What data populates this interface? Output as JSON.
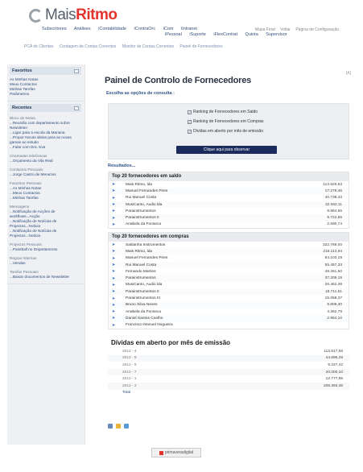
{
  "brand": {
    "part1": "Mais",
    "part2": "Ritmo",
    "accent": "#e2342c"
  },
  "nav_primary": [
    "Subscritores",
    "Análises",
    "iContabilidade",
    "iContraOrc",
    "iCom",
    "iIntranet",
    "iPessoal",
    "iSuporte",
    "iFlexContrat",
    "Quinta",
    "Supervisor"
  ],
  "nav_top_right": [
    "Mapa Final",
    "Voltar",
    "Página de Configuração"
  ],
  "nav_secondary": [
    "PCA de Clientes",
    "Contagem de Contas Correntes",
    "Monitor de Contas Correntes",
    "Painel de Fornecedores"
  ],
  "zoom_label": "[A]",
  "sidebar": {
    "favorites": {
      "title": "Favoritos",
      "items": [
        "As Minhas Notas",
        "Meus Contactos",
        "Minhas Tarefas",
        "Parâmetros"
      ]
    },
    "recent": {
      "title": "Recentes",
      "groups": [
        {
          "label": "Bloco de Notas",
          "items": [
            "...Reunião com departamento sobre Newsletter",
            "...Ligar para a escola da Mariana",
            "...Propor Novas ideias para as novas gamas ao estudo",
            "...Falar com Dra. Eva"
          ]
        },
        {
          "label": "Chamadas telefónicas",
          "items": [
            "...Orçamento da Vila Real"
          ]
        },
        {
          "label": "Contactos Pessoais",
          "items": [
            "...Jorge Castro de Menezes"
          ]
        },
        {
          "label": "Favoritos Pessoais",
          "items": [
            "...As Minhas Notas",
            "...Meus Contactos",
            "...Minhas Tarefas"
          ]
        },
        {
          "label": "Mensagens",
          "items": [
            "...Notificação de Acções de workflows...Acção",
            "...Notificação de Notícias de Projectos...Notícia",
            "...Notificação de Notícias de Projectos...Notícia"
          ]
        },
        {
          "label": "Projectos Pessoais",
          "items": [
            "...Paintball no Departamento"
          ]
        },
        {
          "label": "Regras Internas",
          "items": [
            "...Vendas"
          ]
        },
        {
          "label": "Tarefas Pessoais",
          "items": [
            "...Baixar documentos de Newsletter"
          ]
        }
      ]
    }
  },
  "main": {
    "title": "Painel de Controlo de Fornecedores",
    "options_title": "Escolha as opções de consulta :",
    "options": [
      "Ranking de Fornecedores em Saldo",
      "Ranking de Fornecedores em Compras",
      "Dívidas em aberto por mês de emissão"
    ],
    "button": "Clique aqui para observar",
    "results_label": "Resultados...",
    "section1": {
      "title": "Top 20 fornecedores em saldo",
      "rows": [
        {
          "name": "Mais Ritmo, lda",
          "value": "113.625,53"
        },
        {
          "name": "Manuel Fernandes Pires",
          "value": "17.278,46"
        },
        {
          "name": "Rui Manuel Costa",
          "value": "40.738,33"
        },
        {
          "name": "MusiCanto, Audio lda",
          "value": "32.052,11"
        },
        {
          "name": "Parainstrumentos",
          "value": "9.864,65"
        },
        {
          "name": "Parainstrumentos II",
          "value": "5.722,55"
        },
        {
          "name": "Anabela da Fonseca",
          "value": "2.690,74"
        }
      ]
    },
    "section2": {
      "title": "Top 20 fornecedores em compras",
      "rows": [
        {
          "name": "Saldanha Instrumentos",
          "value": "322.789,00"
        },
        {
          "name": "Mais Ritmo, lda",
          "value": "218.113,94"
        },
        {
          "name": "Manuel Fernandes Pires",
          "value": "84.103,19"
        },
        {
          "name": "Rui Manuel Costa",
          "value": "55.457,33"
        },
        {
          "name": "Fernando Martins",
          "value": "48.261,50"
        },
        {
          "name": "Parainstrumentos",
          "value": "37.209,15"
        },
        {
          "name": "MusiCanto, Audio lda",
          "value": "26.462,39"
        },
        {
          "name": "Parainstrumentos II",
          "value": "18.711,51"
        },
        {
          "name": "Parainstrumentos III",
          "value": "15.068,37"
        },
        {
          "name": "Bruno Silva Neves",
          "value": "9.809,30"
        },
        {
          "name": "Anabela da Fonseca",
          "value": "4.362,78"
        },
        {
          "name": "Daniel Santos Coelho",
          "value": "2.954,10"
        },
        {
          "name": "Francisco Manuel Nogueira",
          "value": ""
        }
      ]
    },
    "section3": {
      "title": "Dívidas em aberto por mês de emissão",
      "rows": [
        {
          "label": "2012 - 4",
          "value": "113.617,58"
        },
        {
          "label": "2012 - 5",
          "value": "44.696,29"
        },
        {
          "label": "2012 - 6",
          "value": "9.227,42"
        },
        {
          "label": "2012 - 7",
          "value": "20.000,10"
        },
        {
          "label": "2012 - 1",
          "value": "12.777,85"
        },
        {
          "label": "2012 - 2",
          "value": "208.393,46"
        },
        {
          "label": "Total",
          "value": ""
        }
      ]
    },
    "footer_icons": [
      "edit-icon",
      "star-icon",
      "users-icon"
    ],
    "footer_brand": "primaveradigital"
  }
}
